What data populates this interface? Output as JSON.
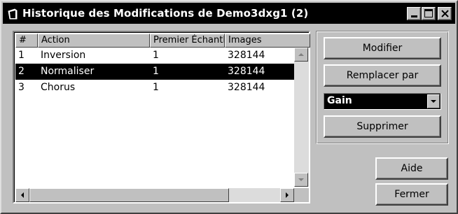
{
  "window": {
    "title": "Historique des Modifications de Demo3dxg1 (2)",
    "icons": {
      "app": "doc-icon",
      "minimize": "minimize-icon",
      "maximize": "maximize-icon",
      "close": "close-icon"
    }
  },
  "list": {
    "columns": [
      "#",
      "Action",
      "Premier Échantl",
      "Images"
    ],
    "rows": [
      {
        "num": "1",
        "action": "Inversion",
        "first": "1",
        "images": "328144",
        "selected": false
      },
      {
        "num": "2",
        "action": "Normaliser",
        "first": "1",
        "images": "328144",
        "selected": true
      },
      {
        "num": "3",
        "action": "Chorus",
        "first": "1",
        "images": "328144",
        "selected": false
      }
    ]
  },
  "actions": {
    "modify_label": "Modifier",
    "replace_label": "Remplacer par",
    "replace_with_value": "Gain",
    "delete_label": "Supprimer"
  },
  "footer": {
    "help_label": "Aide",
    "close_label": "Fermer"
  },
  "colors": {
    "selection": "#000000",
    "face": "#c0c0c0"
  }
}
